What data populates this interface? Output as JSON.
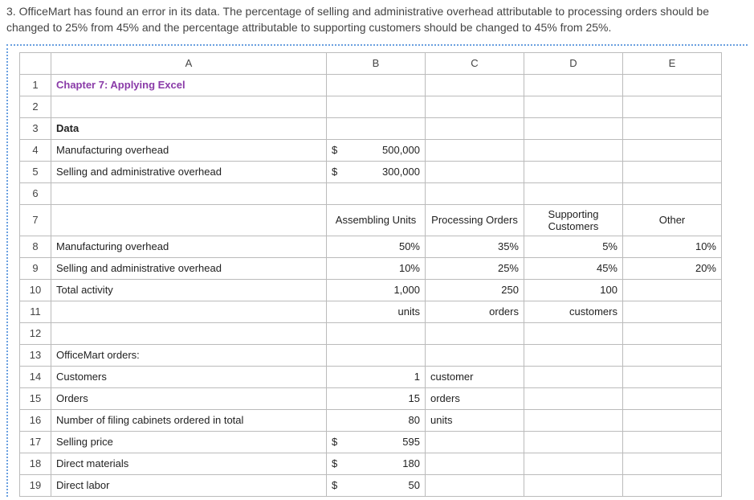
{
  "question": "3. OfficeMart has found an error in its data. The percentage of selling and administrative overhead attributable to processing orders should be changed to 25% from 45% and the percentage attributable to supporting customers should be changed to 45% from 25%.",
  "columns": {
    "A": "A",
    "B": "B",
    "C": "C",
    "D": "D",
    "E": "E"
  },
  "rowNumbers": {
    "1": "1",
    "2": "2",
    "3": "3",
    "4": "4",
    "5": "5",
    "6": "6",
    "7": "7",
    "8": "8",
    "9": "9",
    "10": "10",
    "11": "11",
    "12": "12",
    "13": "13",
    "14": "14",
    "15": "15",
    "16": "16",
    "17": "17",
    "18": "18",
    "19": "19"
  },
  "cells": {
    "A1": "Chapter 7: Applying Excel",
    "A3": "Data",
    "A4": "Manufacturing overhead",
    "B4_sym": "$",
    "B4_num": "500,000",
    "A5": "Selling and administrative overhead",
    "B5_sym": "$",
    "B5_num": "300,000",
    "B7": "Assembling Units",
    "C7": "Processing Orders",
    "D7": "Supporting Customers",
    "E7": "Other",
    "A8": "Manufacturing overhead",
    "B8": "50%",
    "C8": "35%",
    "D8": "5%",
    "E8": "10%",
    "A9": "Selling and administrative overhead",
    "B9": "10%",
    "C9": "25%",
    "D9": "45%",
    "E9": "20%",
    "A10": "Total activity",
    "B10": "1,000",
    "C10": "250",
    "D10": "100",
    "B11": "units",
    "C11": "orders",
    "D11": "customers",
    "A13": "OfficeMart orders:",
    "A14": "Customers",
    "B14": "1",
    "C14": "customer",
    "A15": "Orders",
    "B15": "15",
    "C15": "orders",
    "A16": "Number of filing cabinets ordered in total",
    "B16": "80",
    "C16": "units",
    "A17": "Selling price",
    "B17_sym": "$",
    "B17_num": "595",
    "A18": "Direct materials",
    "B18_sym": "$",
    "B18_num": "180",
    "A19": "Direct labor",
    "B19_sym": "$",
    "B19_num": "50"
  }
}
